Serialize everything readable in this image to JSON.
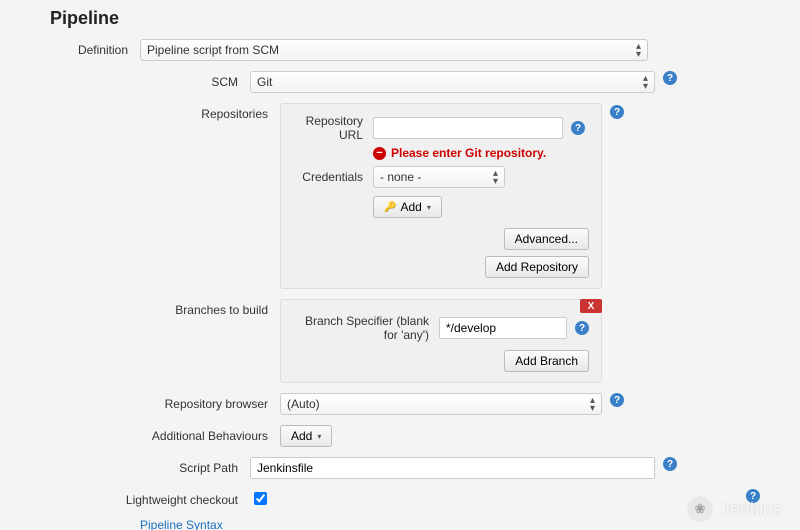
{
  "title": "Pipeline",
  "definition": {
    "label": "Definition",
    "value": "Pipeline script from SCM"
  },
  "scm": {
    "label": "SCM",
    "value": "Git"
  },
  "repositories": {
    "label": "Repositories",
    "url_label": "Repository URL",
    "url_value": "",
    "error": "Please enter Git repository.",
    "credentials_label": "Credentials",
    "credentials_value": "- none -",
    "add_button": "Add",
    "advanced_button": "Advanced...",
    "add_repo_button": "Add Repository"
  },
  "branches": {
    "label": "Branches to build",
    "specifier_label": "Branch Specifier (blank for 'any')",
    "specifier_value": "*/develop",
    "add_branch_button": "Add Branch",
    "delete_label": "X"
  },
  "repo_browser": {
    "label": "Repository browser",
    "value": "(Auto)"
  },
  "behaviours": {
    "label": "Additional Behaviours",
    "add_button": "Add"
  },
  "script_path": {
    "label": "Script Path",
    "value": "Jenkinsfile"
  },
  "lightweight": {
    "label": "Lightweight checkout",
    "checked": true
  },
  "syntax_link": "Pipeline Syntax",
  "footer": "Jenkins",
  "icons": {
    "updown": "▴\n▾",
    "down": "▾",
    "help": "?",
    "minus": "−",
    "key": "🔑",
    "wechat": "❀"
  }
}
